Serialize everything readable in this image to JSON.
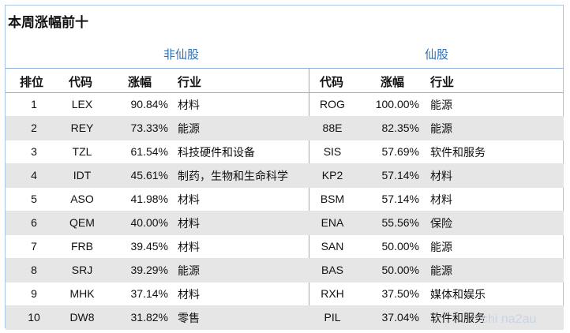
{
  "title": "本周涨幅前十",
  "groups": {
    "non_penny": "非仙股",
    "penny": "仙股"
  },
  "headers": {
    "rank": "排位",
    "code_left": "代码",
    "change_left": "涨幅",
    "industry_left": "行业",
    "code_right": "代码",
    "change_right": "涨幅",
    "industry_right": "行业"
  },
  "rows": [
    {
      "rank": "1",
      "l_code": "LEX",
      "l_change": "90.84%",
      "l_industry": "材料",
      "r_code": "ROG",
      "r_change": "100.00%",
      "r_industry": "能源"
    },
    {
      "rank": "2",
      "l_code": "REY",
      "l_change": "73.33%",
      "l_industry": "能源",
      "r_code": "88E",
      "r_change": "82.35%",
      "r_industry": "能源"
    },
    {
      "rank": "3",
      "l_code": "TZL",
      "l_change": "61.54%",
      "l_industry": "科技硬件和设备",
      "r_code": "SIS",
      "r_change": "57.69%",
      "r_industry": "软件和服务"
    },
    {
      "rank": "4",
      "l_code": "IDT",
      "l_change": "45.61%",
      "l_industry": "制药，生物和生命科学",
      "r_code": "KP2",
      "r_change": "57.14%",
      "r_industry": "材料"
    },
    {
      "rank": "5",
      "l_code": "ASO",
      "l_change": "41.98%",
      "l_industry": "材料",
      "r_code": "BSM",
      "r_change": "57.14%",
      "r_industry": "材料"
    },
    {
      "rank": "6",
      "l_code": "QEM",
      "l_change": "40.00%",
      "l_industry": "材料",
      "r_code": "ENA",
      "r_change": "55.56%",
      "r_industry": "保险"
    },
    {
      "rank": "7",
      "l_code": "FRB",
      "l_change": "39.45%",
      "l_industry": "材料",
      "r_code": "SAN",
      "r_change": "50.00%",
      "r_industry": "能源"
    },
    {
      "rank": "8",
      "l_code": "SRJ",
      "l_change": "39.29%",
      "l_industry": "能源",
      "r_code": "BAS",
      "r_change": "50.00%",
      "r_industry": "能源"
    },
    {
      "rank": "9",
      "l_code": "MHK",
      "l_change": "37.14%",
      "l_industry": "材料",
      "r_code": "RXH",
      "r_change": "37.50%",
      "r_industry": "媒体和娱乐"
    },
    {
      "rank": "10",
      "l_code": "DW8",
      "l_change": "31.82%",
      "l_industry": "零售",
      "r_code": "PIL",
      "r_change": "37.04%",
      "r_industry": "软件和服务"
    }
  ],
  "watermark": "chi na2au",
  "colors": {
    "accent": "#2f6fb5",
    "border": "#8aaedc",
    "alt_row": "#e6e6e6"
  }
}
